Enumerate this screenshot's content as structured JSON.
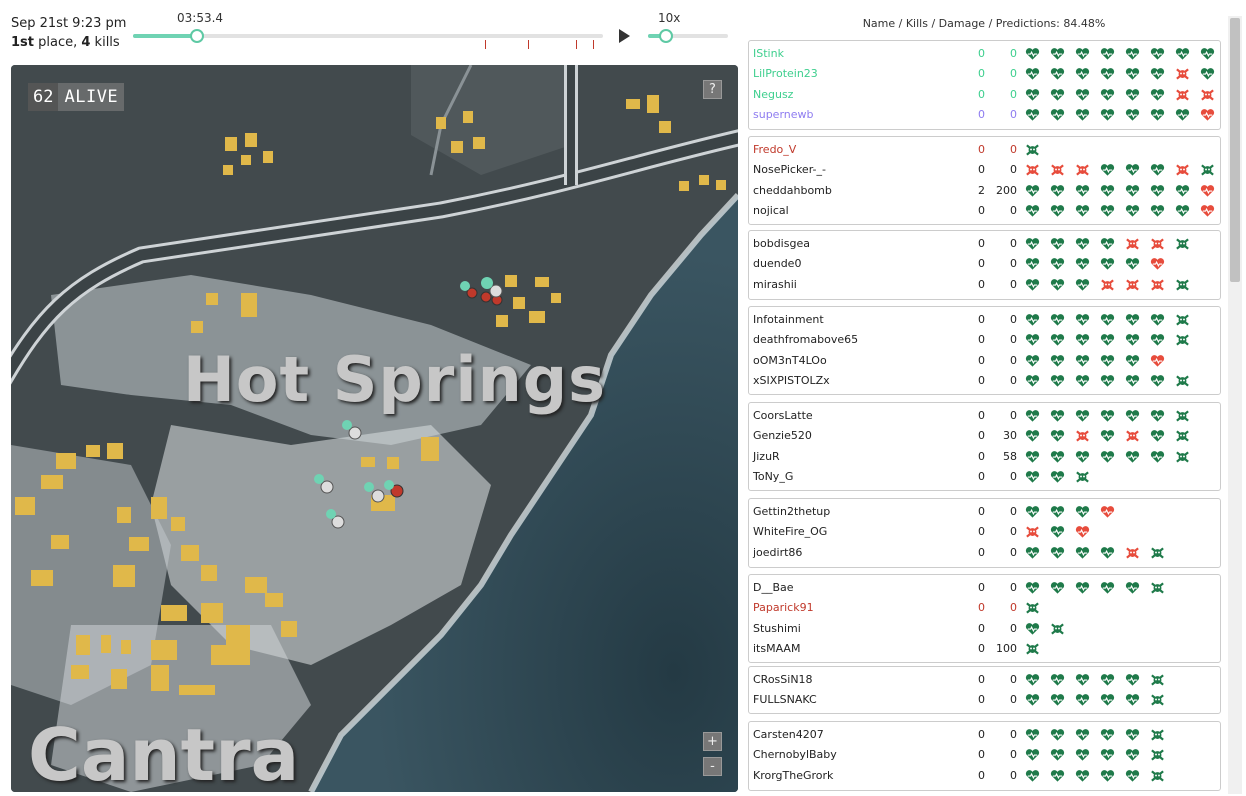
{
  "header": {
    "date": "Sep 21st 9:23 pm",
    "place_num": "1st",
    "place_text": " place, ",
    "kills_num": "4",
    "kills_text": " kills",
    "time": "03:53.4",
    "speed": "10x",
    "timeline_progress": 0.139,
    "speed_progress": 0.2
  },
  "map": {
    "alive_count": "62",
    "alive_label": "ALIVE",
    "help": "?",
    "zoom_in": "+",
    "zoom_out": "-",
    "labels": [
      "Hot Springs",
      "Cantra"
    ]
  },
  "predictions_title": "Name / Kills / Damage / Predictions: 84.48%",
  "colors": {
    "ok": "#1f7a4a",
    "bad": "#e74c3c",
    "self": "#3ecf8e",
    "purple": "#8e7cf0",
    "dead": "#c0392b"
  },
  "teams": [
    {
      "players": [
        {
          "name": "IStink",
          "kills": "0",
          "damage": "0",
          "color": "self",
          "icons": [
            "h",
            "h",
            "h",
            "h",
            "h",
            "h",
            "h",
            "h"
          ]
        },
        {
          "name": "LilProtein23",
          "kills": "0",
          "damage": "0",
          "color": "self",
          "icons": [
            "h",
            "h",
            "h",
            "h",
            "h",
            "h",
            "sr",
            "h"
          ]
        },
        {
          "name": "Negusz",
          "kills": "0",
          "damage": "0",
          "color": "self",
          "icons": [
            "h",
            "h",
            "h",
            "h",
            "h",
            "h",
            "sr",
            "sr"
          ]
        },
        {
          "name": "supernewb",
          "kills": "0",
          "damage": "0",
          "color": "purple",
          "icons": [
            "h",
            "h",
            "h",
            "h",
            "h",
            "h",
            "h",
            "hr"
          ]
        }
      ]
    },
    {
      "players": [
        {
          "name": "Fredo_V",
          "kills": "0",
          "damage": "0",
          "color": "dead",
          "icons": [
            "s"
          ]
        },
        {
          "name": "NosePicker-_-",
          "kills": "0",
          "damage": "0",
          "color": "",
          "icons": [
            "sr",
            "sr",
            "sr",
            "h",
            "h",
            "h",
            "sr",
            "s"
          ]
        },
        {
          "name": "cheddahbomb",
          "kills": "2",
          "damage": "200",
          "color": "",
          "icons": [
            "h",
            "h",
            "h",
            "h",
            "h",
            "h",
            "h",
            "hr"
          ]
        },
        {
          "name": "nojical",
          "kills": "0",
          "damage": "0",
          "color": "",
          "icons": [
            "h",
            "h",
            "h",
            "h",
            "h",
            "h",
            "h",
            "hr"
          ]
        }
      ]
    },
    {
      "players": [
        {
          "name": "bobdisgea",
          "kills": "0",
          "damage": "0",
          "color": "",
          "icons": [
            "h",
            "h",
            "h",
            "h",
            "sr",
            "sr",
            "s"
          ]
        },
        {
          "name": "duende0",
          "kills": "0",
          "damage": "0",
          "color": "",
          "icons": [
            "h",
            "h",
            "h",
            "h",
            "h",
            "hr"
          ]
        },
        {
          "name": "mirashii",
          "kills": "0",
          "damage": "0",
          "color": "",
          "icons": [
            "h",
            "h",
            "h",
            "sr",
            "sr",
            "sr",
            "s"
          ]
        }
      ]
    },
    {
      "players": [
        {
          "name": "Infotainment",
          "kills": "0",
          "damage": "0",
          "color": "",
          "icons": [
            "h",
            "h",
            "h",
            "h",
            "h",
            "h",
            "s"
          ]
        },
        {
          "name": "deathfromabove65",
          "kills": "0",
          "damage": "0",
          "color": "",
          "icons": [
            "h",
            "h",
            "h",
            "h",
            "h",
            "h",
            "s"
          ]
        },
        {
          "name": "oOM3nT4LOo",
          "kills": "0",
          "damage": "0",
          "color": "",
          "icons": [
            "h",
            "h",
            "h",
            "h",
            "h",
            "hr"
          ]
        },
        {
          "name": "xSIXPISTOLZx",
          "kills": "0",
          "damage": "0",
          "color": "",
          "icons": [
            "h",
            "h",
            "h",
            "h",
            "h",
            "h",
            "s"
          ]
        }
      ]
    },
    {
      "players": [
        {
          "name": "CoorsLatte",
          "kills": "0",
          "damage": "0",
          "color": "",
          "icons": [
            "h",
            "h",
            "h",
            "h",
            "h",
            "h",
            "s"
          ]
        },
        {
          "name": "Genzie520",
          "kills": "0",
          "damage": "30",
          "color": "",
          "icons": [
            "h",
            "h",
            "sr",
            "h",
            "sr",
            "h",
            "s"
          ]
        },
        {
          "name": "JizuR",
          "kills": "0",
          "damage": "58",
          "color": "",
          "icons": [
            "h",
            "h",
            "h",
            "h",
            "h",
            "h",
            "s"
          ]
        },
        {
          "name": "ToNy_G",
          "kills": "0",
          "damage": "0",
          "color": "",
          "icons": [
            "h",
            "h",
            "s"
          ]
        }
      ]
    },
    {
      "players": [
        {
          "name": "Gettin2thetup",
          "kills": "0",
          "damage": "0",
          "color": "",
          "icons": [
            "h",
            "h",
            "h",
            "hr"
          ]
        },
        {
          "name": "WhiteFire_OG",
          "kills": "0",
          "damage": "0",
          "color": "",
          "icons": [
            "sr",
            "h",
            "hr"
          ]
        },
        {
          "name": "joedirt86",
          "kills": "0",
          "damage": "0",
          "color": "",
          "icons": [
            "h",
            "h",
            "h",
            "h",
            "sr",
            "s"
          ]
        }
      ]
    },
    {
      "players": [
        {
          "name": "D__Bae",
          "kills": "0",
          "damage": "0",
          "color": "",
          "icons": [
            "h",
            "h",
            "h",
            "h",
            "h",
            "s"
          ]
        },
        {
          "name": "Paparick91",
          "kills": "0",
          "damage": "0",
          "color": "dead",
          "icons": [
            "s"
          ]
        },
        {
          "name": "Stushimi",
          "kills": "0",
          "damage": "0",
          "color": "",
          "icons": [
            "h",
            "s"
          ]
        },
        {
          "name": "itsMAAM",
          "kills": "0",
          "damage": "100",
          "color": "",
          "icons": [
            "s"
          ]
        }
      ]
    },
    {
      "players": [
        {
          "name": "CRosSiN18",
          "kills": "0",
          "damage": "0",
          "color": "",
          "icons": [
            "h",
            "h",
            "h",
            "h",
            "h",
            "s"
          ]
        },
        {
          "name": "FULLSNAKC",
          "kills": "0",
          "damage": "0",
          "color": "",
          "icons": [
            "h",
            "h",
            "h",
            "h",
            "h",
            "s"
          ]
        }
      ]
    },
    {
      "players": [
        {
          "name": "Carsten4207",
          "kills": "0",
          "damage": "0",
          "color": "",
          "icons": [
            "h",
            "h",
            "h",
            "h",
            "h",
            "s"
          ]
        },
        {
          "name": "ChernobylBaby",
          "kills": "0",
          "damage": "0",
          "color": "",
          "icons": [
            "h",
            "h",
            "h",
            "h",
            "h",
            "s"
          ]
        },
        {
          "name": "KrorgTheGrork",
          "kills": "0",
          "damage": "0",
          "color": "",
          "icons": [
            "h",
            "h",
            "h",
            "h",
            "h",
            "s"
          ]
        }
      ]
    }
  ]
}
